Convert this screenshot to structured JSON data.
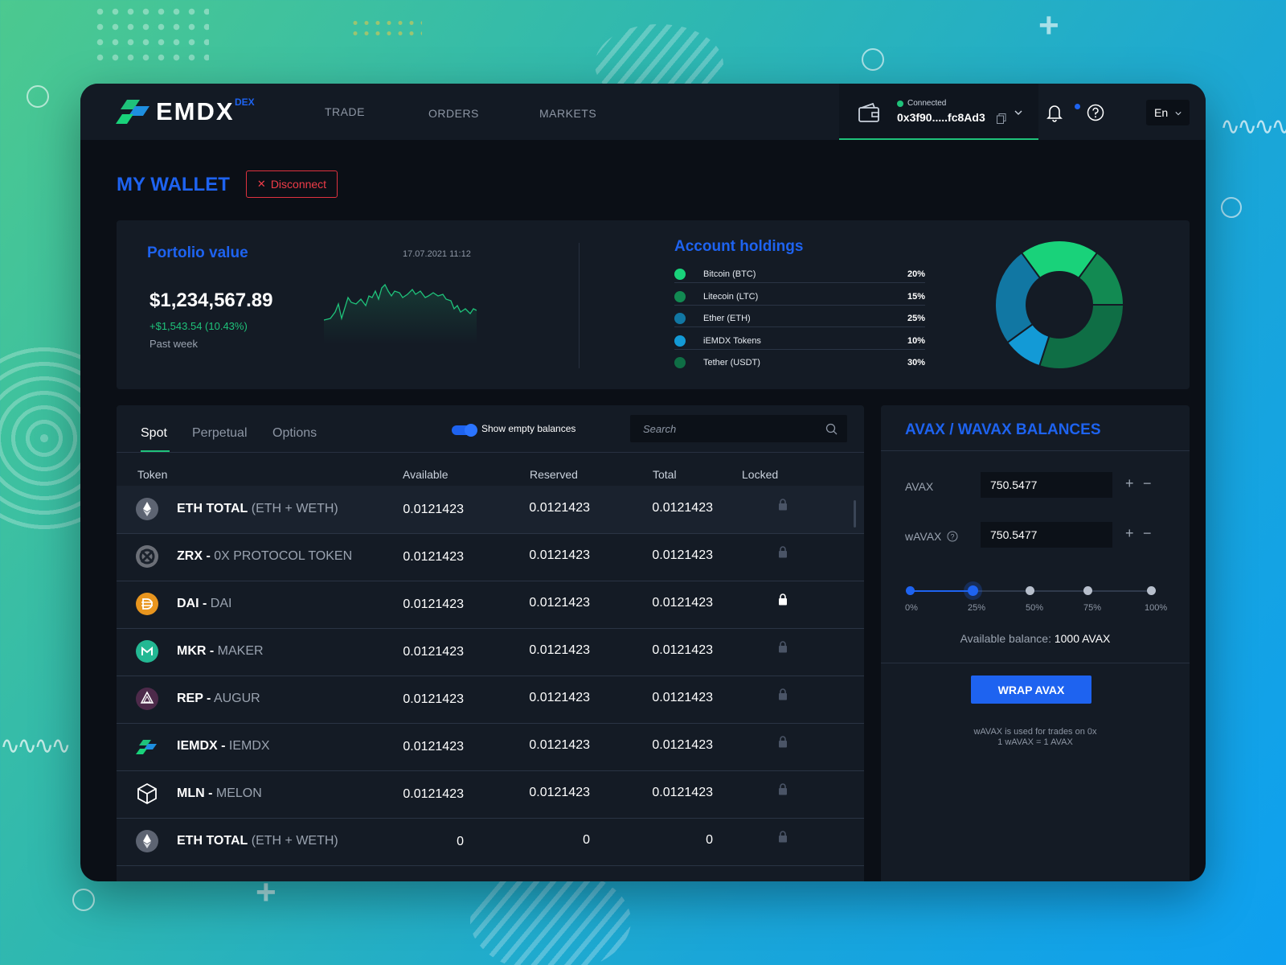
{
  "brand": {
    "name": "EMDX",
    "tag": "DEX"
  },
  "nav": [
    "TRADE",
    "ORDERS",
    "MARKETS"
  ],
  "wallet": {
    "status": "Connected",
    "address": "0x3f90.....fc8Ad3"
  },
  "language": "En",
  "page": {
    "title": "MY WALLET",
    "disconnect_label": "Disconnect"
  },
  "portfolio": {
    "title": "Portolio value",
    "date": "17.07.2021 11:12",
    "value": "$1,234,567.89",
    "change": "+$1,543.54 (10.43%)",
    "period": "Past week"
  },
  "holdings": {
    "title": "Account holdings",
    "items": [
      {
        "label": "Bitcoin (BTC)",
        "pct": "20%",
        "value": 20,
        "color": "#19d27a"
      },
      {
        "label": "Litecoin (LTC)",
        "pct": "15%",
        "value": 15,
        "color": "#128a52"
      },
      {
        "label": "Ether (ETH)",
        "pct": "25%",
        "value": 25,
        "color": "#1177a3"
      },
      {
        "label": "iEMDX Tokens",
        "pct": "10%",
        "value": 10,
        "color": "#139ad6"
      },
      {
        "label": "Tether (USDT)",
        "pct": "30%",
        "value": 30,
        "color": "#0f6e45"
      }
    ]
  },
  "tokens": {
    "tabs": [
      "Spot",
      "Perpetual",
      "Options"
    ],
    "toggle_label": "Show empty balances",
    "search_placeholder": "Search",
    "columns": [
      "Token",
      "Available",
      "Reserved",
      "Total",
      "Locked"
    ],
    "rows": [
      {
        "symbol": "ETH TOTAL",
        "name": "(ETH + WETH)",
        "icon": "ethereum-icon",
        "available": "0.0121423",
        "reserved": "0.0121423",
        "total": "0.0121423",
        "locked": false
      },
      {
        "symbol": "ZRX -",
        "name": "0X PROTOCOL TOKEN",
        "icon": "zrx-icon",
        "available": "0.0121423",
        "reserved": "0.0121423",
        "total": "0.0121423",
        "locked": false
      },
      {
        "symbol": "DAI -",
        "name": "DAI",
        "icon": "dai-icon",
        "available": "0.0121423",
        "reserved": "0.0121423",
        "total": "0.0121423",
        "locked": true
      },
      {
        "symbol": "MKR -",
        "name": "MAKER",
        "icon": "maker-icon",
        "available": "0.0121423",
        "reserved": "0.0121423",
        "total": "0.0121423",
        "locked": false
      },
      {
        "symbol": "REP -",
        "name": "AUGUR",
        "icon": "augur-icon",
        "available": "0.0121423",
        "reserved": "0.0121423",
        "total": "0.0121423",
        "locked": false
      },
      {
        "symbol": "IEMDX -",
        "name": "IEMDX",
        "icon": "iemdx-icon",
        "available": "0.0121423",
        "reserved": "0.0121423",
        "total": "0.0121423",
        "locked": false
      },
      {
        "symbol": "MLN -",
        "name": "MELON",
        "icon": "melon-icon",
        "available": "0.0121423",
        "reserved": "0.0121423",
        "total": "0.0121423",
        "locked": false
      },
      {
        "symbol": "ETH TOTAL",
        "name": "(ETH + WETH)",
        "icon": "ethereum-icon",
        "available": "0",
        "reserved": "0",
        "total": "0",
        "locked": false
      }
    ]
  },
  "avax": {
    "title": "AVAX / WAVAX BALANCES",
    "avax_label": "AVAX",
    "avax_value": "750.5477",
    "wavax_label": "wAVAX",
    "wavax_value": "750.5477",
    "slider_labels": [
      "0%",
      "25%",
      "50%",
      "75%",
      "100%"
    ],
    "slider_value": 0.25,
    "available_label": "Available balance:",
    "available_value": "1000 AVAX",
    "wrap_label": "WRAP AVAX",
    "note_line1": "wAVAX is used for trades on 0x",
    "note_line2": "1 wAVAX = 1 AVAX"
  }
}
